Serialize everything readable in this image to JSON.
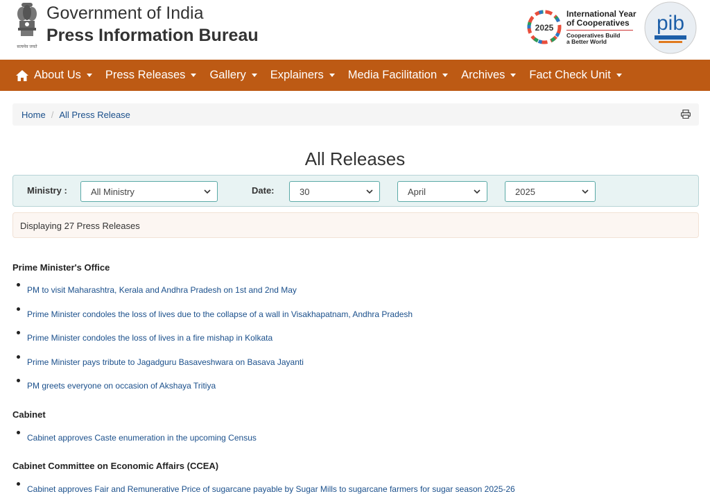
{
  "header": {
    "gov_title": "Government of India",
    "bureau_title": "Press Information Bureau",
    "emblem_caption": "सत्यमेव जयते",
    "iyc": {
      "title_line1": "International Year",
      "title_line2": "of Cooperatives",
      "year": "2025",
      "tagline1": "Cooperatives Build",
      "tagline2": "a Better World"
    },
    "pib_logo_text": "pib"
  },
  "nav": {
    "items": [
      {
        "label": "About Us"
      },
      {
        "label": "Press Releases"
      },
      {
        "label": "Gallery"
      },
      {
        "label": "Explainers"
      },
      {
        "label": "Media Facilitation"
      },
      {
        "label": "Archives"
      },
      {
        "label": "Fact Check Unit"
      }
    ]
  },
  "breadcrumb": {
    "home": "Home",
    "current": "All Press Release"
  },
  "page_title": "All Releases",
  "filters": {
    "ministry_label": "Ministry :",
    "ministry_value": "All Ministry",
    "date_label": "Date:",
    "day_value": "30",
    "month_value": "April",
    "year_value": "2025"
  },
  "count_text": "Displaying 27 Press Releases",
  "groups": [
    {
      "ministry": "Prime Minister's Office",
      "releases": [
        "PM to visit Maharashtra, Kerala and Andhra Pradesh on 1st and 2nd May",
        "Prime Minister condoles the loss of lives due to the collapse of a wall in Visakhapatnam, Andhra Pradesh",
        "Prime Minister condoles the loss of lives in a fire mishap in Kolkata",
        "Prime Minister pays tribute to Jagadguru Basaveshwara on Basava Jayanti",
        "PM greets everyone on occasion of Akshaya Tritiya"
      ]
    },
    {
      "ministry": "Cabinet",
      "releases": [
        "Cabinet approves Caste enumeration in the upcoming Census"
      ]
    },
    {
      "ministry": "Cabinet Committee on Economic Affairs (CCEA)",
      "releases": [
        "Cabinet approves Fair and Remunerative Price of sugarcane payable by Sugar Mills to sugarcane farmers for sugar season 2025-26"
      ]
    }
  ],
  "colors": {
    "nav_bg": "#bd5a14",
    "link": "#1a4f8b",
    "filter_bg": "#e8f3f3"
  }
}
